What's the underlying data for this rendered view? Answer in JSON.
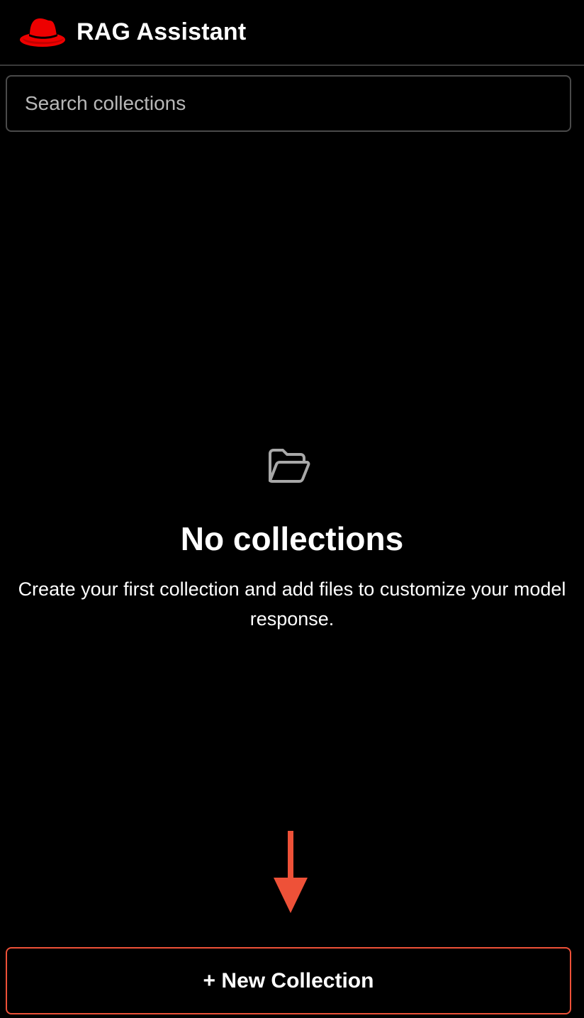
{
  "header": {
    "logo_icon": "red-hat-fedora-icon",
    "title": "RAG Assistant"
  },
  "search": {
    "placeholder": "Search collections",
    "value": ""
  },
  "empty_state": {
    "icon": "folder-open-icon",
    "title": "No collections",
    "description": "Create your first collection and add files to customize your model response."
  },
  "annotation": {
    "icon": "arrow-down-icon",
    "color": "#ee5138"
  },
  "new_collection_button": {
    "label": "+ New Collection",
    "border_color": "#ee5138"
  },
  "colors": {
    "background": "#000000",
    "brand_red": "#ee0000",
    "text": "#ffffff",
    "muted_text": "#b8b8b8"
  }
}
